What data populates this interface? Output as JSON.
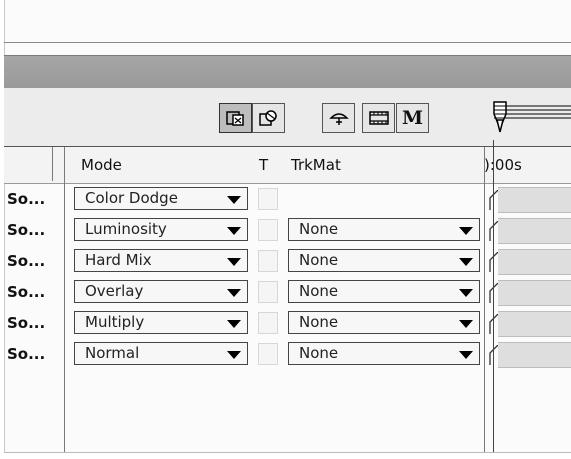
{
  "timeline": {
    "columns": {
      "mode": "Mode",
      "t": "T",
      "trkmat": "TrkMat",
      "time": "):00s"
    },
    "toolbar": {
      "buttons": [
        {
          "icon": "composition-toggle-icon",
          "pressed": true
        },
        {
          "icon": "frame-blend-icon",
          "pressed": false
        },
        {
          "icon": "draft-3d-icon",
          "pressed": false
        },
        {
          "icon": "film-strip-icon",
          "pressed": false
        },
        {
          "icon": "motion-blur-icon",
          "pressed": false,
          "glyph": "M"
        }
      ]
    },
    "rows": [
      {
        "name": "So...",
        "mode": "Color Dodge",
        "trkmat": ""
      },
      {
        "name": "So...",
        "mode": "Luminosity",
        "trkmat": "None"
      },
      {
        "name": "So...",
        "mode": "Hard Mix",
        "trkmat": "None"
      },
      {
        "name": "So...",
        "mode": "Overlay",
        "trkmat": "None"
      },
      {
        "name": "So...",
        "mode": "Multiply",
        "trkmat": "None"
      },
      {
        "name": "So...",
        "mode": "Normal",
        "trkmat": "None"
      }
    ]
  }
}
